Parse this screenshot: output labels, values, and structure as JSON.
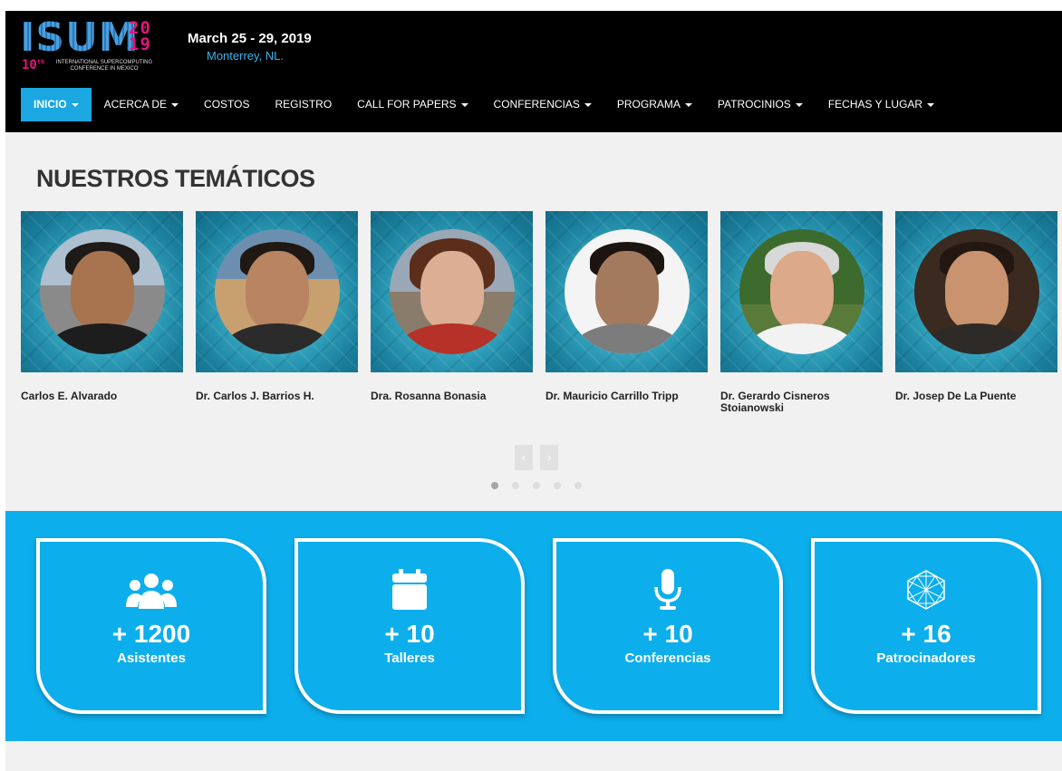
{
  "header": {
    "logo": {
      "text": "ISUM",
      "year": "20\n19",
      "edition": "10",
      "subtitle": "INTERNATIONAL SUPERCOMPUTING CONFERENCE IN MEXICO"
    },
    "date": "March 25 - 29, 2019",
    "city": "Monterrey, NL."
  },
  "nav": [
    {
      "label": "INICIO",
      "dropdown": true,
      "active": true
    },
    {
      "label": "ACERCA DE",
      "dropdown": true
    },
    {
      "label": "COSTOS",
      "dropdown": false
    },
    {
      "label": "REGISTRO",
      "dropdown": false
    },
    {
      "label": "CALL FOR PAPERS",
      "dropdown": true
    },
    {
      "label": "CONFERENCIAS",
      "dropdown": true
    },
    {
      "label": "PROGRAMA",
      "dropdown": true
    },
    {
      "label": "PATROCINIOS",
      "dropdown": true
    },
    {
      "label": "FECHAS Y LUGAR",
      "dropdown": true
    }
  ],
  "tematicos": {
    "title": "NUESTROS TEMÁTICOS",
    "speakers": [
      {
        "name": "Carlos E. Alvarado"
      },
      {
        "name": "Dr. Carlos J. Barrios H."
      },
      {
        "name": "Dra. Rosanna Bonasia"
      },
      {
        "name": "Dr. Mauricio Carrillo Tripp"
      },
      {
        "name": "Dr.     Gerardo      Cisneros Stoianowski"
      },
      {
        "name": "Dr. Josep De La Puente"
      }
    ],
    "prev_label": "‹",
    "next_label": "›",
    "dots": 5,
    "active_dot": 0
  },
  "stats": [
    {
      "icon": "users-icon",
      "value": "+ 1200",
      "label": "Asistentes"
    },
    {
      "icon": "calendar-icon",
      "value": "+ 10",
      "label": "Talleres"
    },
    {
      "icon": "microphone-icon",
      "value": "+ 10",
      "label": "Conferencias"
    },
    {
      "icon": "hexagon-network-icon",
      "value": "+ 16",
      "label": "Patrocinadores"
    }
  ],
  "colors": {
    "accent": "#0daeec",
    "nav_active": "#1ba7e1",
    "topbar": "#000000",
    "logo_pink": "#e3167b"
  }
}
